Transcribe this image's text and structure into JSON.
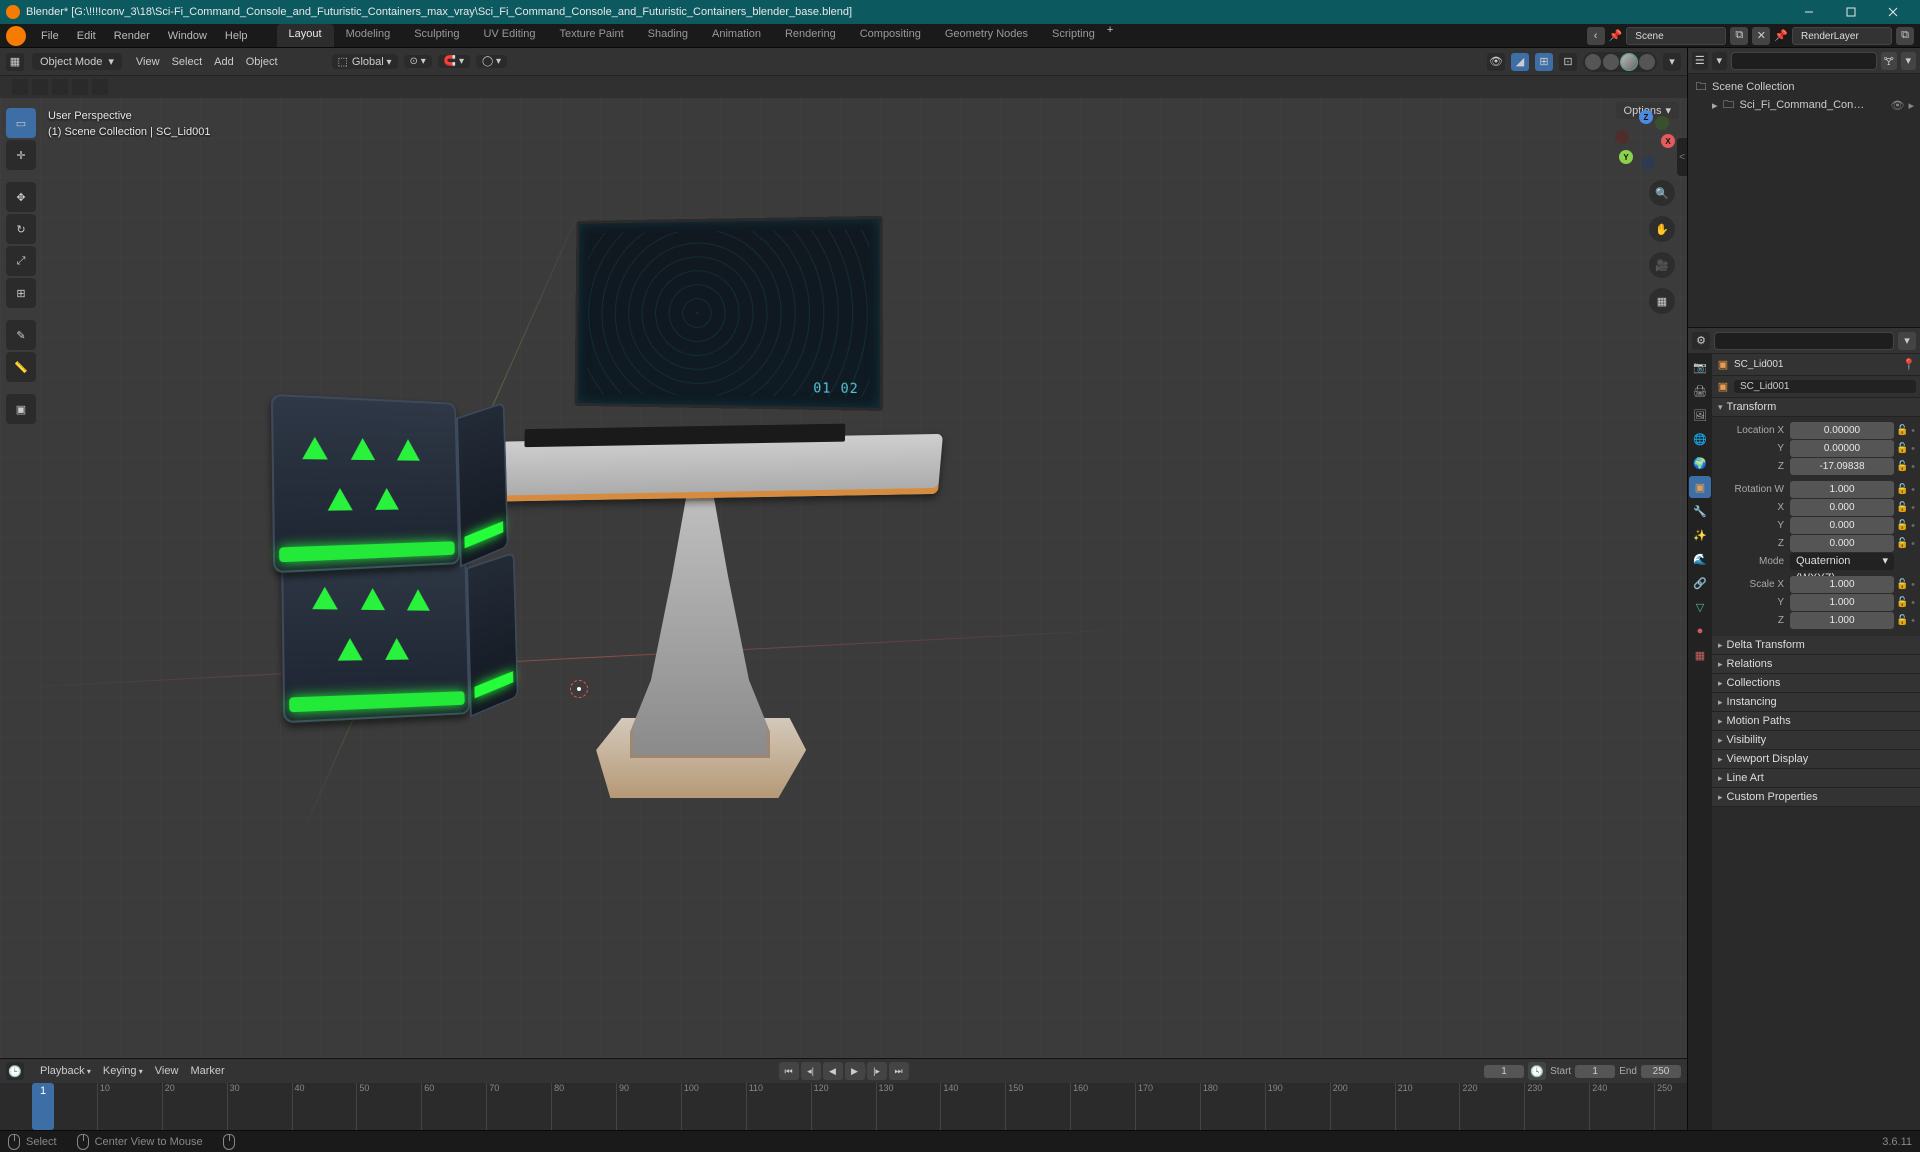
{
  "title": "Blender* [G:\\!!!!conv_3\\18\\Sci-Fi_Command_Console_and_Futuristic_Containers_max_vray\\Sci_Fi_Command_Console_and_Futuristic_Containers_blender_base.blend]",
  "menubar": [
    "File",
    "Edit",
    "Render",
    "Window",
    "Help"
  ],
  "workspaces": [
    "Layout",
    "Modeling",
    "Sculpting",
    "UV Editing",
    "Texture Paint",
    "Shading",
    "Animation",
    "Rendering",
    "Compositing",
    "Geometry Nodes",
    "Scripting"
  ],
  "active_workspace": "Layout",
  "scene": {
    "name": "Scene",
    "renderlayer": "RenderLayer"
  },
  "view3d_header": {
    "mode": "Object Mode",
    "menus": [
      "View",
      "Select",
      "Add",
      "Object"
    ],
    "orientation": "Global",
    "options_label": "Options"
  },
  "viewport_label": {
    "line1": "User Perspective",
    "line2": "(1) Scene Collection | SC_Lid001"
  },
  "monitor_hud": "01  02",
  "outliner": {
    "root": "Scene Collection",
    "item": "Sci_Fi_Command_Console_and_Futuristi"
  },
  "properties": {
    "breadcrumb_obj": "SC_Lid001",
    "datablock": "SC_Lid001",
    "transform": {
      "location": {
        "x": "0.00000",
        "y": "0.00000",
        "z": "-17.09838"
      },
      "rotation": {
        "w": "1.000",
        "x": "0.000",
        "y": "0.000",
        "z": "0.000"
      },
      "mode": "Quaternion (WXYZ)",
      "scale": {
        "x": "1.000",
        "y": "1.000",
        "z": "1.000"
      }
    },
    "panels_open": [
      "Transform"
    ],
    "panels_collapsed": [
      "Delta Transform",
      "Relations",
      "Collections",
      "Instancing",
      "Motion Paths",
      "Visibility",
      "Viewport Display",
      "Line Art",
      "Custom Properties"
    ]
  },
  "timeline": {
    "menus": [
      "Playback",
      "Keying",
      "View",
      "Marker"
    ],
    "current": "1",
    "start_label": "Start",
    "start": "1",
    "end_label": "End",
    "end": "250",
    "ticks": [
      10,
      20,
      30,
      40,
      50,
      60,
      70,
      80,
      90,
      100,
      110,
      120,
      130,
      140,
      150,
      160,
      170,
      180,
      190,
      200,
      210,
      220,
      230,
      240,
      250
    ]
  },
  "statusbar": {
    "hint1": "Select",
    "hint2": "Center View to Mouse",
    "version": "3.6.11"
  },
  "prop_tabs": [
    "render",
    "output",
    "viewlayer",
    "scene",
    "world",
    "object",
    "modifier",
    "particle",
    "physics",
    "constraint",
    "data",
    "material",
    "texture"
  ]
}
